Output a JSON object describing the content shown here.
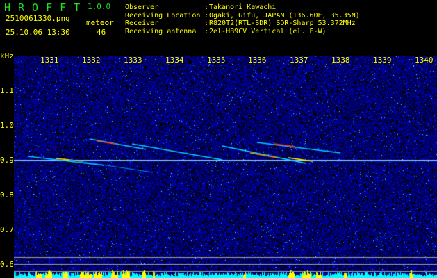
{
  "app": {
    "title": "HROFFT",
    "version": "1.0.0"
  },
  "file_name": "2510061330.png",
  "datetime": "25.10.06 13:30",
  "meteor": {
    "label": "meteor",
    "count": "46"
  },
  "info": [
    {
      "key": "Observer",
      "value": "Takanori Kawachi"
    },
    {
      "key": "Receiving Location",
      "value": "Ogaki, Gifu, JAPAN (136.60E, 35.35N)"
    },
    {
      "key": "Receiver",
      "value": "R820T2(RTL-SDR) SDR-Sharp 53.372MHz"
    },
    {
      "key": "Receiving antenna",
      "value": "2el-HB9CV Vertical (el. E-W)"
    }
  ],
  "separator": ":",
  "axis": {
    "unit": "kHz",
    "y_ticks": [
      "1.1",
      "1.0",
      "0.9",
      "0.8",
      "0.7",
      "0.6"
    ],
    "time_ticks": [
      "1331",
      "1332",
      "1333",
      "1334",
      "1335",
      "1336",
      "1337",
      "1338",
      "1339",
      "1340"
    ]
  },
  "colors": {
    "title": "#22dd22",
    "text": "#ffff00",
    "noise": "#0a1aa0",
    "histogram_cyan": "#00ffff",
    "histogram_yellow": "#ffff00"
  }
}
